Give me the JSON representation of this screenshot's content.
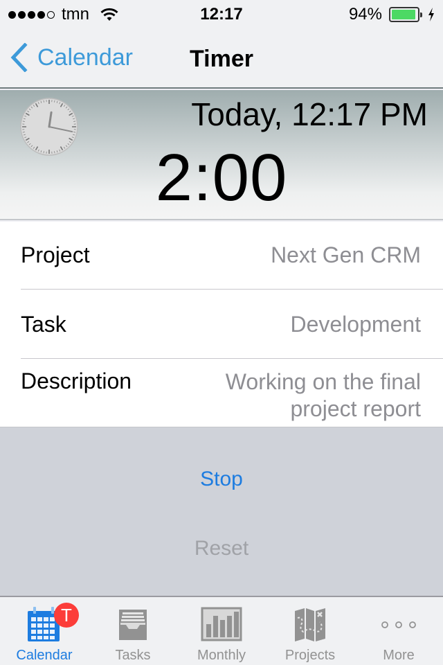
{
  "status_bar": {
    "signal_bars_filled": 4,
    "signal_bars_total": 5,
    "carrier": "tmn",
    "time": "12:17",
    "battery_percent_label": "94%",
    "battery_level": 0.94,
    "charging": true
  },
  "nav": {
    "back_label": "Calendar",
    "title": "Timer"
  },
  "timer": {
    "start_label": "Today, 12:17 PM",
    "elapsed": "2:00",
    "clock_time": "12:17"
  },
  "form": {
    "rows": [
      {
        "label": "Project",
        "value": "Next Gen CRM"
      },
      {
        "label": "Task",
        "value": "Development"
      },
      {
        "label": "Description",
        "value": "Working on the final project report"
      }
    ]
  },
  "actions": {
    "stop_label": "Stop",
    "reset_label": "Reset"
  },
  "tabbar": {
    "active": "Calendar",
    "tabs": [
      {
        "label": "Calendar",
        "icon": "calendar-icon",
        "badge": "T"
      },
      {
        "label": "Tasks",
        "icon": "inbox-tray-icon"
      },
      {
        "label": "Monthly",
        "icon": "bar-chart-icon"
      },
      {
        "label": "Projects",
        "icon": "treasure-map-icon"
      },
      {
        "label": "More",
        "icon": "more-dots-icon"
      }
    ]
  },
  "colors": {
    "accent": "#1d7ce0",
    "nav_link": "#3d9ad9",
    "badge": "#fc3d39",
    "battery": "#4cd964",
    "secondary_text": "#8e8e93",
    "disabled_text": "#a0a2a7"
  }
}
